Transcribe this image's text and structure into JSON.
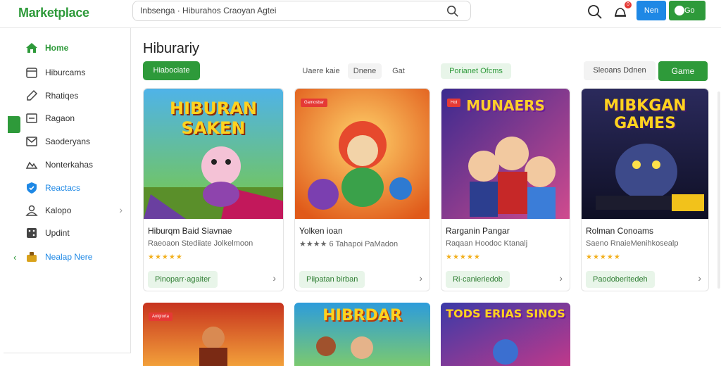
{
  "header": {
    "logo": "Marketplace",
    "search_value": "Inbsenga · Hiburahos Craoyan Agtei",
    "btn_next": "Nen",
    "btn_green": "Go",
    "notif_count": "0",
    "colors": {
      "brand": "#2e9a3a",
      "blue": "#1e88e5"
    }
  },
  "sidebar": {
    "items": [
      {
        "label": "Home",
        "icon": "home-icon"
      },
      {
        "label": "Hiburcams",
        "icon": "calendar-icon"
      },
      {
        "label": "Rhatiqes",
        "icon": "note-icon"
      },
      {
        "label": "Ragaon",
        "icon": "square-icon"
      },
      {
        "label": "Saoderyans",
        "icon": "envelope-icon"
      },
      {
        "label": "Nonterkahas",
        "icon": "cloud-icon"
      },
      {
        "label": "Reactacs",
        "icon": "shield-icon"
      },
      {
        "label": "Kalopo",
        "icon": "user-icon"
      },
      {
        "label": "Updint",
        "icon": "dice-icon"
      },
      {
        "label": "Nealap Nere",
        "icon": "bag-icon"
      }
    ]
  },
  "main": {
    "title": "Hiburariy",
    "filter_active": "Hiabociate",
    "chips": [
      "Uaere kaie",
      "Dnene",
      "Gat",
      "Porianet Ofcms"
    ],
    "sort": "Sleoans Ddnen",
    "game_button": "Game"
  },
  "cards": [
    {
      "name": "Hiburqm Baid Siavnae",
      "sub": "Raeoaon Stediiate Jolkelmoon",
      "stars": "★★★★★",
      "button": "Pinoparr·agaiter",
      "thumb_title": "HIBURAN SAKEN",
      "tag": ""
    },
    {
      "name": "Yolken ioan",
      "sub": "★★★★ 6 Tahapoi PaMadon",
      "stars": "",
      "button": "Piipatan birban",
      "thumb_title": "",
      "tag": "Gamosbar"
    },
    {
      "name": "Rarganin Pangar",
      "sub": "Raqaan Hoodoc Ktanalj",
      "stars": "★★★★★",
      "button": "Ri·canieriedob",
      "thumb_title": "MUNAERS",
      "tag": "Hot"
    },
    {
      "name": "Rolman Conoams",
      "sub": "Saeno RnaieMenihkosealp",
      "stars": "★★★★★",
      "button": "Paodoberitedeh",
      "thumb_title": "MIBKGAN GAMES",
      "tag": ""
    }
  ],
  "row2": [
    {
      "thumb_title": "",
      "tag": "Ankjrorta"
    },
    {
      "thumb_title": "HIBRDAR",
      "tag": ""
    },
    {
      "thumb_title": "TODS ERIAS SINOS",
      "tag": ""
    }
  ]
}
